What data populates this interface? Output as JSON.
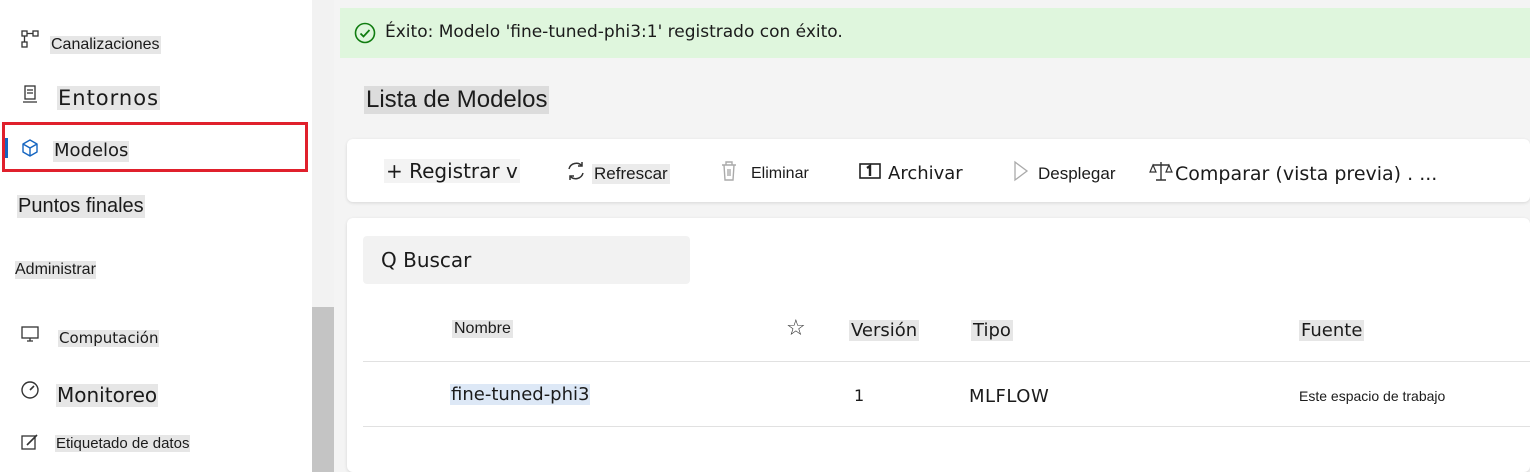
{
  "sidebar": {
    "items": [
      {
        "label": "Canalizaciones",
        "icon": "pipeline-icon"
      },
      {
        "label": "Entornos",
        "icon": "environment-icon"
      },
      {
        "label": "Modelos",
        "icon": "cube-icon",
        "selected": true
      },
      {
        "label": "Puntos finales",
        "icon": "endpoint-icon"
      },
      {
        "label": "Computación",
        "icon": "computer-icon"
      },
      {
        "label": "Monitoreo",
        "icon": "gauge-icon"
      },
      {
        "label": "Etiquetado de datos",
        "icon": "edit-icon"
      }
    ],
    "section_admin": "Administrar"
  },
  "banner": {
    "text": "Éxito: Modelo 'fine-tuned-phi3:1' registrado con éxito.",
    "icon": "success-check-icon",
    "color": "#dff6dd"
  },
  "page": {
    "title": "Lista de Modelos"
  },
  "toolbar": {
    "register": "+ Registrar v",
    "refresh": "Refrescar",
    "delete": "Eliminar",
    "archive": "Archivar",
    "deploy": "Desplegar",
    "compare": "Comparar (vista previa) . ..."
  },
  "search": {
    "label": "Q Buscar"
  },
  "table": {
    "headers": {
      "name": "Nombre",
      "version": "Versión",
      "type": "Tipo",
      "source": "Fuente"
    },
    "rows": [
      {
        "name": "fine-tuned-phi3",
        "version": "1",
        "type": "MLFLOW",
        "source": "Este espacio de trabajo"
      }
    ]
  },
  "colors": {
    "accent": "#1565c0",
    "highlight_border": "#e0202c",
    "success_bg": "#dff6dd",
    "success_icon": "#107c10"
  }
}
